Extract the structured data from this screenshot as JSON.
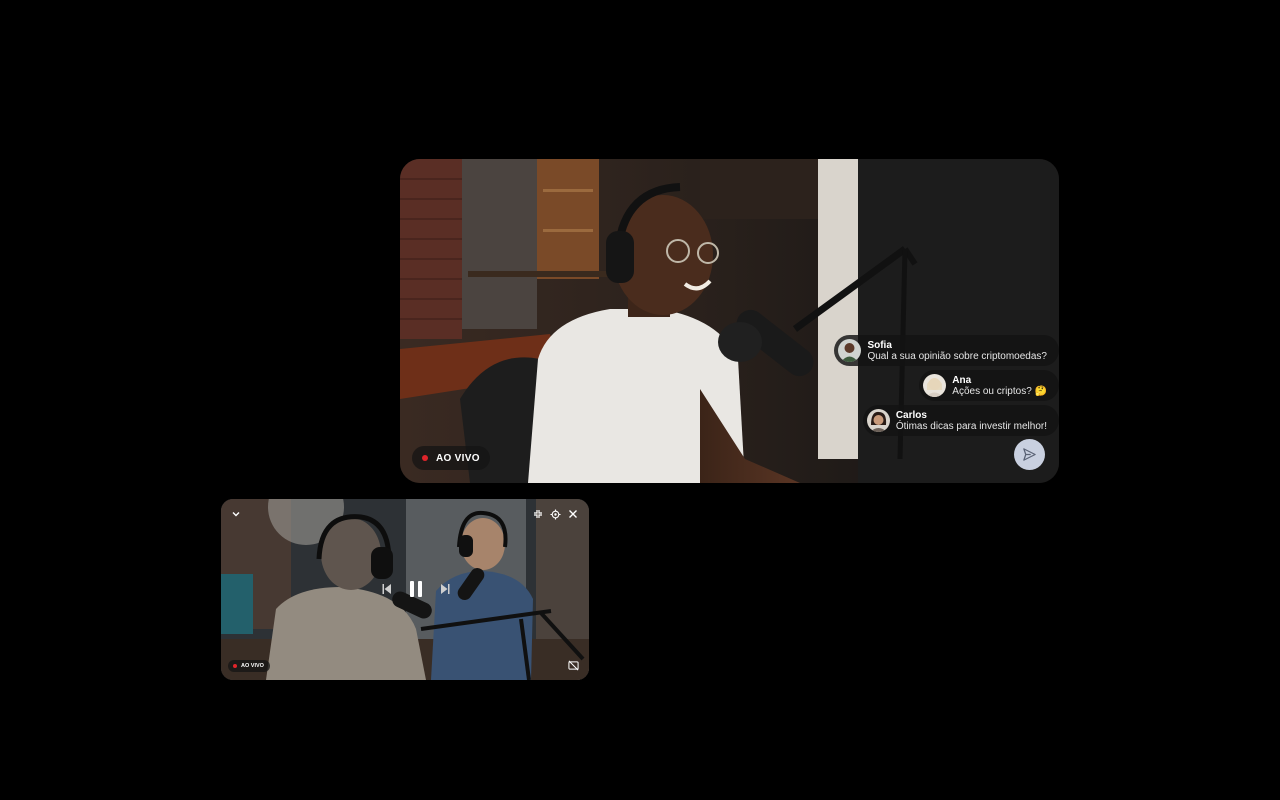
{
  "main_player": {
    "live_label": "AO VIVO",
    "comments": [
      {
        "author": "Sofia",
        "text": "Qual a sua opinião sobre criptomoedas?"
      },
      {
        "author": "Ana",
        "text": "Ações ou criptos? 🤔"
      },
      {
        "author": "Carlos",
        "text": "Ótimas dicas para investir melhor!"
      }
    ]
  },
  "mini_player": {
    "live_label": "AO VIVO",
    "playback_state": "playing"
  },
  "colors": {
    "live_red": "#e0242a",
    "send_button": "#c9d0e0",
    "background": "#000000"
  },
  "icons": [
    "chevron-down-icon",
    "collapse-icon",
    "gear-icon",
    "close-icon",
    "previous-icon",
    "pause-icon",
    "next-icon",
    "captions-off-icon",
    "send-icon"
  ]
}
